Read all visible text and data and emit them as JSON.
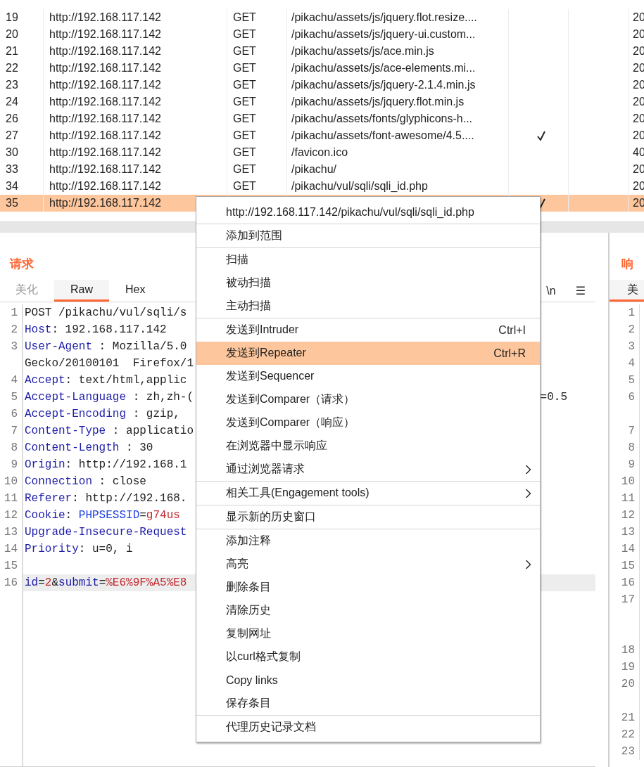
{
  "history_table": {
    "rows": [
      {
        "number": "19",
        "host": "http://192.168.117.142",
        "method": "GET",
        "url": "/pikachu/assets/js/jquery.flot.resize....",
        "column_5_checked": false,
        "status": "20",
        "selected": false
      },
      {
        "number": "20",
        "host": "http://192.168.117.142",
        "method": "GET",
        "url": "/pikachu/assets/js/jquery-ui.custom...",
        "column_5_checked": false,
        "status": "20",
        "selected": false
      },
      {
        "number": "21",
        "host": "http://192.168.117.142",
        "method": "GET",
        "url": "/pikachu/assets/js/ace.min.js",
        "column_5_checked": false,
        "status": "20",
        "selected": false
      },
      {
        "number": "22",
        "host": "http://192.168.117.142",
        "method": "GET",
        "url": "/pikachu/assets/js/ace-elements.mi...",
        "column_5_checked": false,
        "status": "20",
        "selected": false
      },
      {
        "number": "23",
        "host": "http://192.168.117.142",
        "method": "GET",
        "url": "/pikachu/assets/js/jquery-2.1.4.min.js",
        "column_5_checked": false,
        "status": "20",
        "selected": false
      },
      {
        "number": "24",
        "host": "http://192.168.117.142",
        "method": "GET",
        "url": "/pikachu/assets/js/jquery.flot.min.js",
        "column_5_checked": false,
        "status": "20",
        "selected": false
      },
      {
        "number": "26",
        "host": "http://192.168.117.142",
        "method": "GET",
        "url": "/pikachu/assets/fonts/glyphicons-h...",
        "column_5_checked": false,
        "status": "20",
        "selected": false
      },
      {
        "number": "27",
        "host": "http://192.168.117.142",
        "method": "GET",
        "url": "/pikachu/assets/font-awesome/4.5....",
        "column_5_checked": true,
        "status": "20",
        "selected": false
      },
      {
        "number": "30",
        "host": "http://192.168.117.142",
        "method": "GET",
        "url": "/favicon.ico",
        "column_5_checked": false,
        "status": "40",
        "selected": false
      },
      {
        "number": "33",
        "host": "http://192.168.117.142",
        "method": "GET",
        "url": "/pikachu/",
        "column_5_checked": false,
        "status": "20",
        "selected": false
      },
      {
        "number": "34",
        "host": "http://192.168.117.142",
        "method": "GET",
        "url": "/pikachu/vul/sqli/sqli_id.php",
        "column_5_checked": false,
        "status": "20",
        "selected": false
      },
      {
        "number": "35",
        "host": "http://192.168.117.142",
        "column_5_checked": true,
        "status": "20",
        "selected": true
      }
    ]
  },
  "request": {
    "title": "请求",
    "tabs": [
      {
        "label": "美化",
        "selected": false,
        "disabled": true
      },
      {
        "label": "Raw",
        "selected": true,
        "disabled": false
      },
      {
        "label": "Hex",
        "selected": false,
        "disabled": false
      }
    ],
    "tools": [
      "\\n",
      "☰"
    ],
    "lines": [
      {
        "number": "1",
        "segments": [
          {
            "kind": "plain",
            "text": "POST /pikachu/vul/sqli/s"
          }
        ]
      },
      {
        "number": "2",
        "segments": [
          {
            "kind": "key",
            "text": "Host"
          },
          {
            "kind": "plain",
            "text": ": 192.168.117.142"
          }
        ]
      },
      {
        "number": "3",
        "segments": [
          {
            "kind": "key",
            "text": "User-Agent"
          },
          {
            "kind": "plain",
            "text": " : Mozilla/5.0"
          }
        ]
      },
      {
        "segments": [
          {
            "kind": "plain",
            "text": "Gecko/20100101  Firefox/1"
          }
        ]
      },
      {
        "number": "4",
        "segments": [
          {
            "kind": "key",
            "text": "Accept"
          },
          {
            "kind": "plain",
            "text": ": text/html,applic"
          }
        ]
      },
      {
        "number": "5",
        "segments": [
          {
            "kind": "key",
            "text": "Accept-Language"
          },
          {
            "kind": "plain",
            "text": " : zh,zh-("
          }
        ],
        "tail": "=0.5"
      },
      {
        "number": "6",
        "segments": [
          {
            "kind": "key",
            "text": "Accept-Encoding"
          },
          {
            "kind": "plain",
            "text": " : gzip,"
          }
        ]
      },
      {
        "number": "7",
        "segments": [
          {
            "kind": "key",
            "text": "Content-Type"
          },
          {
            "kind": "plain",
            "text": " : applicatio"
          }
        ]
      },
      {
        "number": "8",
        "segments": [
          {
            "kind": "key",
            "text": "Content-Length"
          },
          {
            "kind": "plain",
            "text": " : 30"
          }
        ]
      },
      {
        "number": "9",
        "segments": [
          {
            "kind": "key",
            "text": "Origin"
          },
          {
            "kind": "plain",
            "text": ": http://192.168.1"
          }
        ]
      },
      {
        "number": "10",
        "segments": [
          {
            "kind": "key",
            "text": "Connection"
          },
          {
            "kind": "plain",
            "text": " : close"
          }
        ]
      },
      {
        "number": "11",
        "segments": [
          {
            "kind": "key",
            "text": "Referer"
          },
          {
            "kind": "plain",
            "text": ": http://192.168."
          }
        ]
      },
      {
        "number": "12",
        "segments": [
          {
            "kind": "key",
            "text": "Cookie"
          },
          {
            "kind": "plain",
            "text": ": "
          },
          {
            "kind": "name",
            "text": "PHPSESSID"
          },
          {
            "kind": "plain",
            "text": "="
          },
          {
            "kind": "value",
            "text": "g74us"
          }
        ]
      },
      {
        "number": "13",
        "segments": [
          {
            "kind": "key",
            "text": "Upgrade-Insecure-Request"
          }
        ]
      },
      {
        "number": "14",
        "segments": [
          {
            "kind": "key",
            "text": "Priority"
          },
          {
            "kind": "plain",
            "text": ": u=0, i"
          }
        ]
      },
      {
        "number": "15"
      },
      {
        "number": "16",
        "highlighted": true,
        "segments": [
          {
            "kind": "key",
            "text": "id"
          },
          {
            "kind": "plain",
            "text": "="
          },
          {
            "kind": "value",
            "text": "2"
          },
          {
            "kind": "plain",
            "text": "&"
          },
          {
            "kind": "key",
            "text": "submit"
          },
          {
            "kind": "plain",
            "text": "="
          },
          {
            "kind": "value",
            "text": "%E6%9F%A5%E8"
          }
        ]
      }
    ]
  },
  "response": {
    "title": "响",
    "tabs": [
      {
        "label": "美",
        "selected": true
      }
    ],
    "lines": [
      {
        "kind": "number",
        "text": "1"
      },
      {
        "kind": "number",
        "text": "2"
      },
      {
        "kind": "number",
        "text": "3"
      },
      {
        "kind": "number",
        "text": "4"
      },
      {
        "kind": "number",
        "text": "5"
      },
      {
        "kind": "number",
        "text": "6"
      },
      {
        "kind": "wrap"
      },
      {
        "kind": "number",
        "text": "7"
      },
      {
        "kind": "number",
        "text": "8"
      },
      {
        "kind": "number",
        "text": "9"
      },
      {
        "kind": "number",
        "text": "10"
      },
      {
        "kind": "number",
        "text": "11"
      },
      {
        "kind": "number",
        "text": "12"
      },
      {
        "kind": "number",
        "text": "13"
      },
      {
        "kind": "number",
        "text": "14"
      },
      {
        "kind": "number",
        "text": "15"
      },
      {
        "kind": "number",
        "text": "16"
      },
      {
        "kind": "number",
        "text": "17"
      },
      {
        "kind": "wrap"
      },
      {
        "kind": "wrap"
      },
      {
        "kind": "number",
        "text": "18"
      },
      {
        "kind": "number",
        "text": "19"
      },
      {
        "kind": "number",
        "text": "20"
      },
      {
        "kind": "wrap"
      },
      {
        "kind": "number",
        "text": "21"
      },
      {
        "kind": "number",
        "text": "22"
      },
      {
        "kind": "number",
        "text": "23"
      }
    ]
  },
  "context_menu": {
    "groups": [
      [
        {
          "label": "http://192.168.117.142/pikachu/vul/sqli/sqli_id.php",
          "selected": false,
          "submenu": false
        }
      ],
      [
        {
          "label": "添加到范围",
          "selected": false,
          "submenu": false
        }
      ],
      [
        {
          "label": "扫描",
          "selected": false,
          "submenu": false
        },
        {
          "label": "被动扫描",
          "selected": false,
          "submenu": false
        },
        {
          "label": "主动扫描",
          "selected": false,
          "submenu": false
        }
      ],
      [
        {
          "label": "发送到Intruder",
          "shortcut": "Ctrl+I",
          "selected": false,
          "submenu": false
        },
        {
          "label": "发送到Repeater",
          "shortcut": "Ctrl+R",
          "selected": true,
          "submenu": false
        },
        {
          "label": "发送到Sequencer",
          "selected": false,
          "submenu": false
        },
        {
          "label": "发送到Comparer（请求）",
          "selected": false,
          "submenu": false
        },
        {
          "label": "发送到Comparer（响应）",
          "selected": false,
          "submenu": false
        },
        {
          "label": "在浏览器中显示响应",
          "selected": false,
          "submenu": false
        },
        {
          "label": "通过浏览器请求",
          "selected": false,
          "submenu": true
        }
      ],
      [
        {
          "label": "相关工具(Engagement tools)",
          "selected": false,
          "submenu": true
        }
      ],
      [
        {
          "label": "显示新的历史窗口",
          "selected": false,
          "submenu": false
        }
      ],
      [
        {
          "label": "添加注释",
          "selected": false,
          "submenu": false
        },
        {
          "label": "高亮",
          "selected": false,
          "submenu": true
        },
        {
          "label": "删除条目",
          "selected": false,
          "submenu": false
        },
        {
          "label": "清除历史",
          "selected": false,
          "submenu": false
        },
        {
          "label": "复制网址",
          "selected": false,
          "submenu": false
        },
        {
          "label": "以curl格式复制",
          "selected": false,
          "submenu": false
        },
        {
          "label": "Copy links",
          "selected": false,
          "submenu": false
        },
        {
          "label": "保存条目",
          "selected": false,
          "submenu": false
        }
      ],
      [
        {
          "label": "代理历史记录文档",
          "selected": false,
          "submenu": false
        }
      ]
    ]
  }
}
